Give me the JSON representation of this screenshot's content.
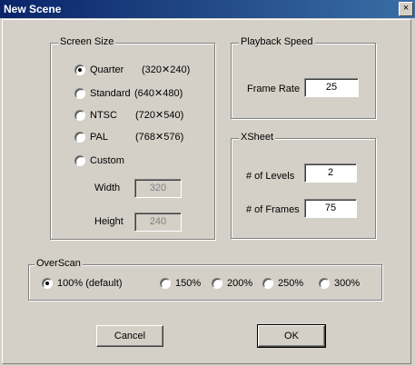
{
  "window": {
    "title": "New Scene",
    "close_glyph": "×"
  },
  "screen_size": {
    "legend": "Screen Size",
    "options": [
      {
        "label": "Quarter",
        "dims": "(320✕240)",
        "checked": true
      },
      {
        "label": "Standard",
        "dims": "(640✕480)",
        "checked": false
      },
      {
        "label": "NTSC",
        "dims": "(720✕540)",
        "checked": false
      },
      {
        "label": "PAL",
        "dims": "(768✕576)",
        "checked": false
      },
      {
        "label": "Custom",
        "dims": "",
        "checked": false
      }
    ],
    "width_label": "Width",
    "width_value": "320",
    "height_label": "Height",
    "height_value": "240"
  },
  "playback": {
    "legend": "Playback Speed",
    "frame_rate_label": "Frame Rate",
    "frame_rate_value": "25"
  },
  "xsheet": {
    "legend": "XSheet",
    "levels_label": "# of Levels",
    "levels_value": "2",
    "frames_label": "# of Frames",
    "frames_value": "75"
  },
  "overscan": {
    "legend": "OverScan",
    "options": [
      {
        "label": "100% (default)",
        "checked": true
      },
      {
        "label": "150%",
        "checked": false
      },
      {
        "label": "200%",
        "checked": false
      },
      {
        "label": "250%",
        "checked": false
      },
      {
        "label": "300%",
        "checked": false
      }
    ]
  },
  "buttons": {
    "cancel": "Cancel",
    "ok": "OK"
  }
}
